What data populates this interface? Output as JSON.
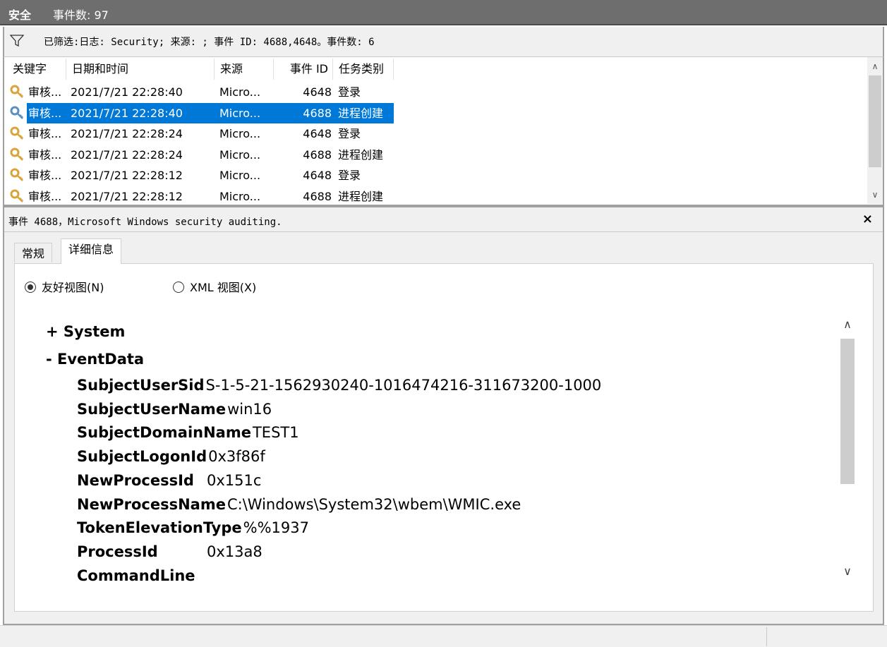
{
  "titlebar": {
    "name": "安全",
    "count_label": "事件数: 97"
  },
  "filter": {
    "text": "已筛选:日志: Security; 来源: ; 事件 ID: 4688,4648。事件数: 6",
    "icon": "filter-icon"
  },
  "table": {
    "columns": [
      "关键字",
      "日期和时间",
      "来源",
      "事件 ID",
      "任务类别"
    ],
    "rows": [
      {
        "keyword": "审核...",
        "datetime": "2021/7/21 22:28:40",
        "source": "Micro...",
        "event_id": "4648",
        "task": "登录",
        "selected": false
      },
      {
        "keyword": "审核...",
        "datetime": "2021/7/21 22:28:40",
        "source": "Micro...",
        "event_id": "4688",
        "task": "进程创建",
        "selected": true
      },
      {
        "keyword": "审核...",
        "datetime": "2021/7/21 22:28:24",
        "source": "Micro...",
        "event_id": "4648",
        "task": "登录",
        "selected": false
      },
      {
        "keyword": "审核...",
        "datetime": "2021/7/21 22:28:24",
        "source": "Micro...",
        "event_id": "4688",
        "task": "进程创建",
        "selected": false
      },
      {
        "keyword": "审核...",
        "datetime": "2021/7/21 22:28:12",
        "source": "Micro...",
        "event_id": "4648",
        "task": "登录",
        "selected": false
      },
      {
        "keyword": "审核...",
        "datetime": "2021/7/21 22:28:12",
        "source": "Micro...",
        "event_id": "4688",
        "task": "进程创建",
        "selected": false
      }
    ]
  },
  "detail": {
    "header": "事件 4688，Microsoft Windows security auditing.",
    "close": "×",
    "tabs": {
      "general": "常规",
      "details": "详细信息"
    },
    "radios": {
      "friendly": "友好视图(N)",
      "xml": "XML 视图(X)"
    },
    "tree": {
      "system": "+ System",
      "eventdata": "- EventData"
    },
    "fields": [
      {
        "key": "SubjectUserSid",
        "value": "S-1-5-21-1562930240-1016474216-311673200-1000"
      },
      {
        "key": "SubjectUserName",
        "value": "win16"
      },
      {
        "key": "SubjectDomainName",
        "value": "TEST1"
      },
      {
        "key": "SubjectLogonId",
        "value": "0x3f86f"
      },
      {
        "key": "NewProcessId",
        "value": "0x151c"
      },
      {
        "key": "NewProcessName",
        "value": "C:\\Windows\\System32\\wbem\\WMIC.exe"
      },
      {
        "key": "TokenElevationType",
        "value": "%%1937"
      },
      {
        "key": "ProcessId",
        "value": "0x13a8"
      },
      {
        "key": "CommandLine",
        "value": ""
      }
    ]
  },
  "colors": {
    "selection": "#0078d7",
    "titlebar": "#6e6e6e",
    "key_icon": "#d9a43a"
  }
}
